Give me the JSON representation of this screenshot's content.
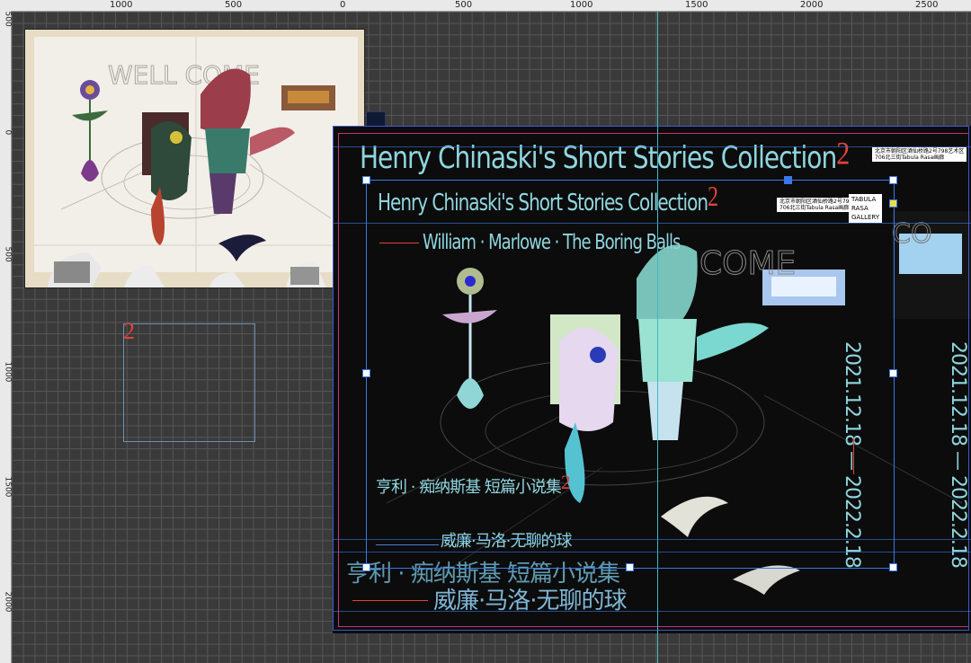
{
  "rulers": {
    "top": [
      "1000",
      "500",
      "0",
      "500",
      "1000",
      "1500",
      "2000",
      "2500"
    ],
    "left": [
      "500",
      "0",
      "500",
      "1000",
      "1500",
      "2000"
    ]
  },
  "poster": {
    "title_en": "Henry Chinaski's Short Stories Collection",
    "title_en_superscript": "2",
    "authors_en": "William · Marlowe · The Boring Balls",
    "title_cn": "亨利 · 痴纳斯基 短篇小说集",
    "title_cn_superscript": "2",
    "authors_cn": "威廉·马洛·无聊的球",
    "dates": "2021.12.18 — 2022.2.18",
    "gallery_name": [
      "TABULA",
      "RASA",
      "GALLERY"
    ],
    "address": [
      "北京市朝阳区酒仙桥路2号798艺术区",
      "706北三街Tabula Rasa画廊"
    ],
    "welcome_text": "WELL COME",
    "superscript_alone": "2"
  },
  "colors": {
    "accent_red": "#e0443b",
    "guide_cyan": "#3fb9c4",
    "selection_blue": "#3b78e7",
    "text_cyan": "#8fd6df"
  }
}
